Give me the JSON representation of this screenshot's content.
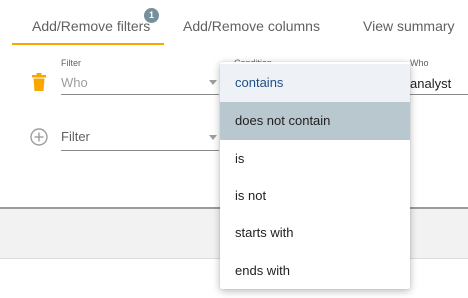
{
  "tabs": [
    {
      "label": "Add/Remove filters",
      "badge": "1",
      "active": true
    },
    {
      "label": "Add/Remove columns",
      "active": false
    },
    {
      "label": "View summary",
      "active": false
    }
  ],
  "filter_row": {
    "field_label": "Filter",
    "field_value": "Who",
    "condition_label": "Condition",
    "value_label": "Who",
    "value_text": "analyst",
    "delete_icon": "trash-icon"
  },
  "new_filter_row": {
    "field_placeholder": "Filter",
    "add_icon": "plus-circle-icon"
  },
  "condition_dropdown": {
    "options": [
      {
        "label": "contains",
        "state": "highlighted"
      },
      {
        "label": "does not contain",
        "state": "selected"
      },
      {
        "label": "is",
        "state": "normal"
      },
      {
        "label": "is not",
        "state": "normal"
      },
      {
        "label": "starts with",
        "state": "normal"
      },
      {
        "label": "ends with",
        "state": "normal"
      }
    ]
  },
  "colors": {
    "accent": "#f6a800",
    "badge": "#78909c",
    "option_selected": "#b9c7ce",
    "option_highlighted": "#eef2f6"
  }
}
